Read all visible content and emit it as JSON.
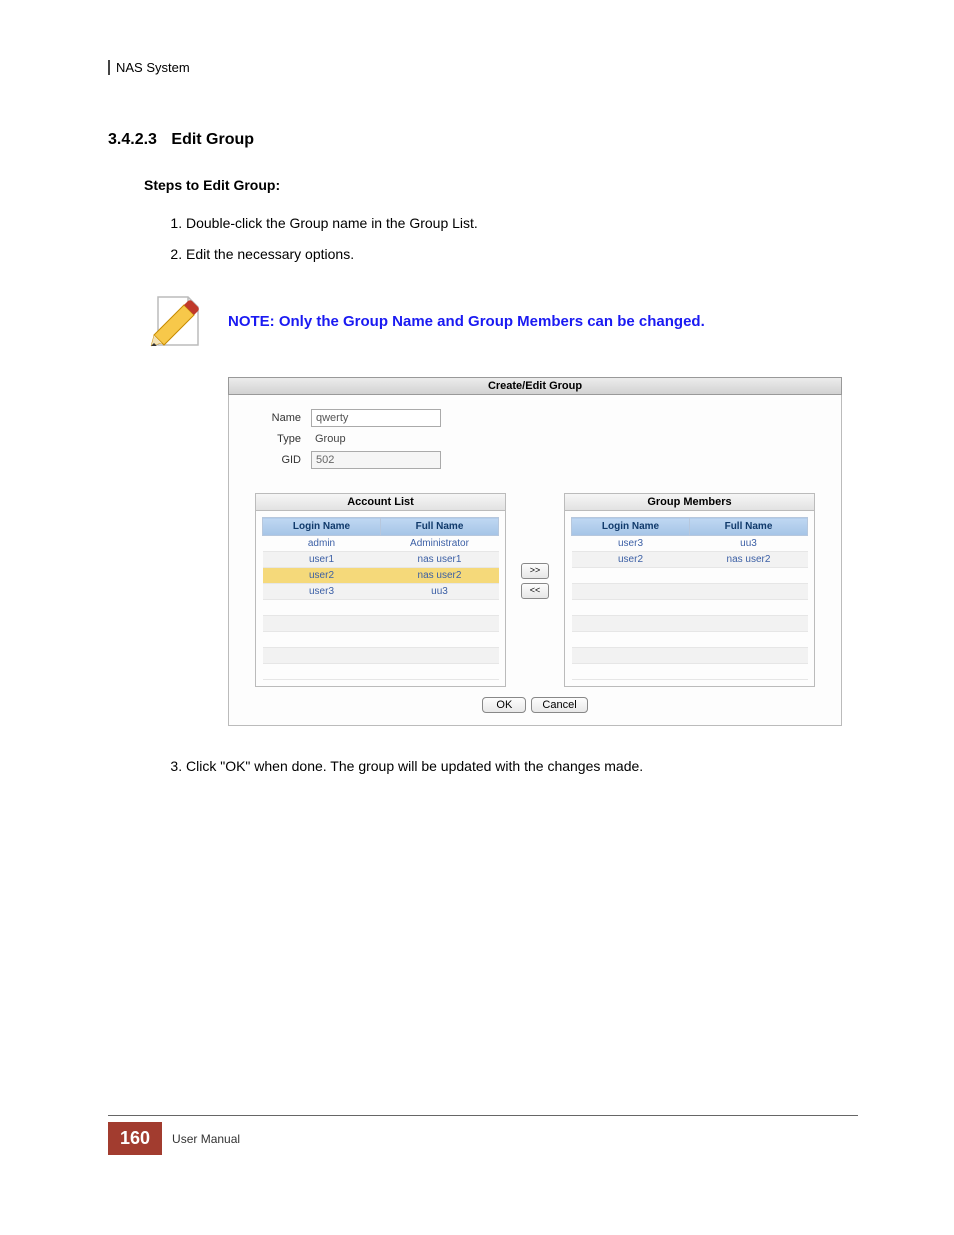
{
  "header": {
    "product": "NAS System"
  },
  "section": {
    "number": "3.4.2.3",
    "title": "Edit Group"
  },
  "steps_heading": "Steps to Edit Group:",
  "steps": [
    "Double-click the Group name in the Group List.",
    "Edit the necessary options.",
    "Click \"OK\" when done. The group will be updated with the changes made."
  ],
  "note": {
    "text": "NOTE: Only the Group Name and Group Members can be changed."
  },
  "dialog": {
    "title": "Create/Edit Group",
    "fields": {
      "name_label": "Name",
      "name_value": "qwerty",
      "type_label": "Type",
      "type_value": "Group",
      "gid_label": "GID",
      "gid_value": "502"
    },
    "account_list": {
      "title": "Account List",
      "columns": {
        "login": "Login Name",
        "full": "Full Name"
      },
      "rows": [
        {
          "login": "admin",
          "full": "Administrator"
        },
        {
          "login": "user1",
          "full": "nas user1"
        },
        {
          "login": "user2",
          "full": "nas user2",
          "selected": true
        },
        {
          "login": "user3",
          "full": "uu3"
        }
      ]
    },
    "group_members": {
      "title": "Group Members",
      "columns": {
        "login": "Login Name",
        "full": "Full Name"
      },
      "rows": [
        {
          "login": "user3",
          "full": "uu3"
        },
        {
          "login": "user2",
          "full": "nas user2"
        }
      ]
    },
    "move_buttons": {
      "add": ">>",
      "remove": "<<"
    },
    "footer": {
      "ok": "OK",
      "cancel": "Cancel"
    }
  },
  "footer": {
    "page": "160",
    "label": "User Manual"
  }
}
